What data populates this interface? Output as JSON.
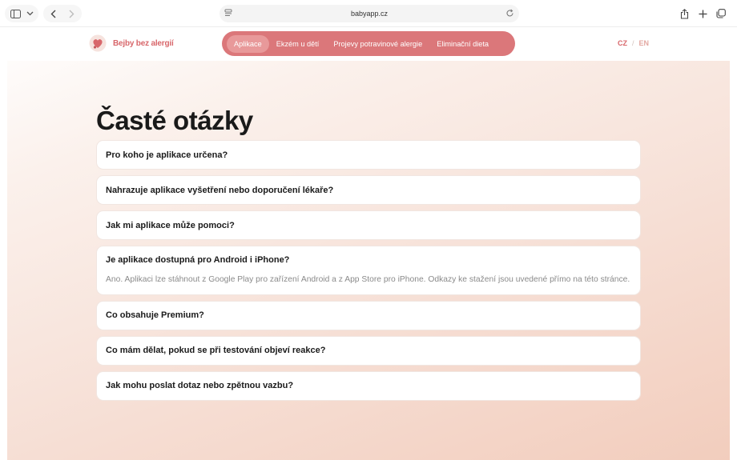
{
  "browser": {
    "url": "babyapp.cz"
  },
  "site": {
    "brand": "Bejby bez alergií",
    "nav": [
      {
        "label": "Aplikace",
        "active": true
      },
      {
        "label": "Ekzém u dětí",
        "active": false
      },
      {
        "label": "Projevy potravinové alergie",
        "active": false
      },
      {
        "label": "Eliminační dieta",
        "active": false
      }
    ],
    "lang": {
      "cz": "CZ",
      "separator": "/",
      "en": "EN",
      "active": "CZ"
    }
  },
  "faq": {
    "title": "Časté otázky",
    "items": [
      {
        "question": "Pro koho je aplikace určena?"
      },
      {
        "question": "Nahrazuje aplikace vyšetření nebo doporučení lékaře?"
      },
      {
        "question": "Jak mi aplikace může pomoci?"
      },
      {
        "question": "Je aplikace dostupná pro Android i iPhone?",
        "answer": "Ano. Aplikaci lze stáhnout z Google Play pro zařízení Android a z App Store pro iPhone. Odkazy ke stažení jsou uvedené přímo na této stránce."
      },
      {
        "question": "Co obsahuje Premium?"
      },
      {
        "question": "Co mám dělat, pokud se při testování objeví reakce?"
      },
      {
        "question": "Jak mohu poslat dotaz nebo zpětnou vazbu?"
      }
    ]
  },
  "colors": {
    "brand": "#d8676b",
    "menu_bg": "#db777a"
  }
}
